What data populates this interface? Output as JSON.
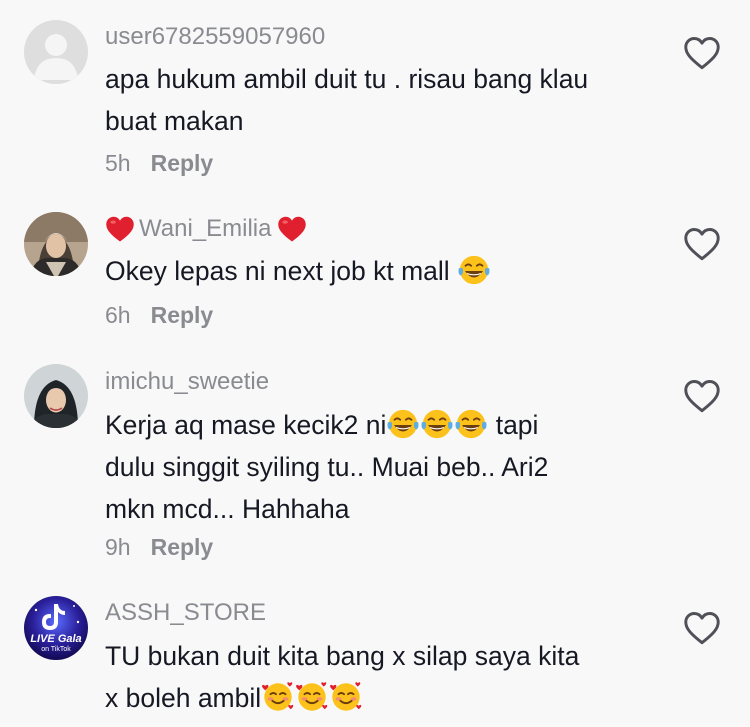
{
  "comments": [
    {
      "username": "user6782559057960",
      "text_lines": [
        "apa hukum ambil duit tu . risau bang klau",
        "buat makan"
      ],
      "time": "5h",
      "reply_label": "Reply",
      "avatar": "default-avatar"
    },
    {
      "username": "Wani_Emilia",
      "text": "Okey lepas ni next job kt mall",
      "time": "6h",
      "reply_label": "Reply",
      "avatar": "user-photo",
      "username_decor": "red-heart-emoji",
      "text_emoji": "tears-of-joy-emoji"
    },
    {
      "username": "imichu_sweetie",
      "line1_a": "Kerja aq mase kecik2 ni",
      "line1_b": " tapi",
      "line2": "dulu singgit syiling tu.. Muai beb.. Ari2",
      "line3": "mkn mcd... Hahhaha",
      "time": "9h",
      "reply_label": "Reply",
      "avatar": "user-photo",
      "text_emoji": "tears-of-joy-emoji"
    },
    {
      "username": "ASSH_STORE",
      "line1": "TU bukan duit kita bang x silap saya kita",
      "line2": "x boleh ambil",
      "avatar": "live-gala-badge",
      "avatar_text_1": "LIVE Gala",
      "avatar_text_2": "on TikTok",
      "text_emoji": "smiling-face-with-hearts-emoji"
    }
  ],
  "icons": {
    "like": "heart-outline-icon"
  },
  "colors": {
    "background": "#f8f8f8",
    "username": "#8a8b91",
    "text": "#161823",
    "heart_red": "#e0202e"
  }
}
